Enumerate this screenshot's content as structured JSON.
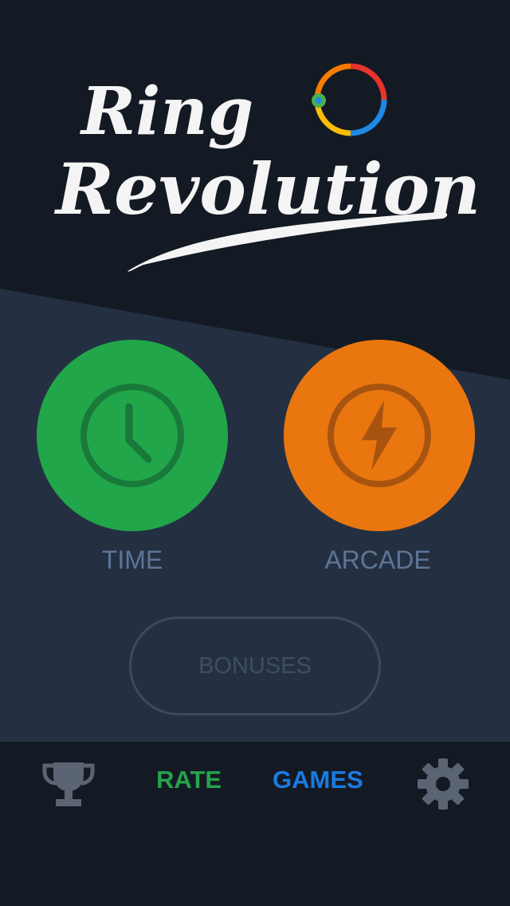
{
  "logo": {
    "line1": "Ring",
    "line2": "Revolution",
    "ring_colors": [
      "#e8342b",
      "#fbbc05",
      "#1e88e5",
      "#f57c00"
    ]
  },
  "modes": [
    {
      "label": "TIME",
      "icon": "clock-icon",
      "color": "#21a64a"
    },
    {
      "label": "ARCADE",
      "icon": "lightning-icon",
      "color": "#ea760f"
    }
  ],
  "bonuses": {
    "label": "BONUSES"
  },
  "nav": {
    "trophy_icon": "trophy-icon",
    "rate_label": "RATE",
    "games_label": "GAMES",
    "settings_icon": "gear-icon"
  },
  "colors": {
    "background_dark": "#141a24",
    "background_panel": "#243042",
    "label_blue": "#5d7596",
    "rate_green": "#25a34b",
    "games_blue": "#1a7be2"
  }
}
